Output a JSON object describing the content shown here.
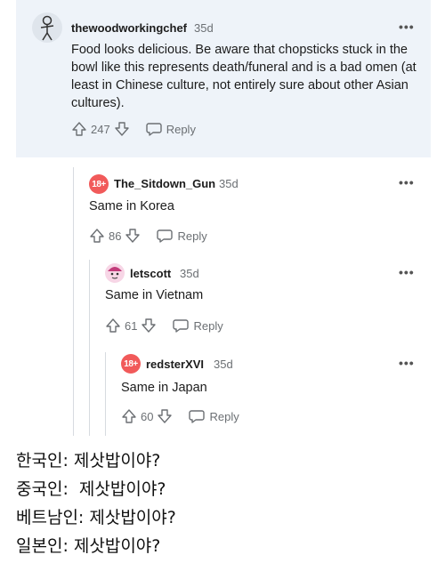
{
  "comments": [
    {
      "username": "thewoodworkingchef",
      "age": "35d",
      "text": "Food looks delicious. Be aware that chopsticks stuck in the bowl like this represents death/funeral and is a bad omen (at least in Chinese culture, not entirely sure about other Asian cultures).",
      "votes": "247",
      "reply_label": "Reply",
      "avatar_icon": "stick-figure-avatar"
    },
    {
      "username": "The_Sitdown_Gun",
      "age": "35d",
      "text": "Same in Korea",
      "votes": "86",
      "reply_label": "Reply",
      "avatar_icon": "nsfw-18-avatar",
      "avatar_text": "18+"
    },
    {
      "username": "letscott",
      "age": "35d",
      "text": "Same in Vietnam",
      "votes": "61",
      "reply_label": "Reply",
      "avatar_icon": "cartoon-avatar"
    },
    {
      "username": "redsterXVI",
      "age": "35d",
      "text": "Same in Japan",
      "votes": "60",
      "reply_label": "Reply",
      "avatar_icon": "nsfw-18-avatar",
      "avatar_text": "18+"
    }
  ],
  "more_label": "•••",
  "captions": [
    "한국인: 제삿밥이야?",
    "중국인:  제삿밥이야?",
    "베트남인: 제삿밥이야?",
    "일본인: 제삿밥이야?"
  ],
  "colors": {
    "highlight_bg": "#eef3f9",
    "nsfw_avatar": "#f15a5a",
    "muted_text": "#6b6f73"
  }
}
